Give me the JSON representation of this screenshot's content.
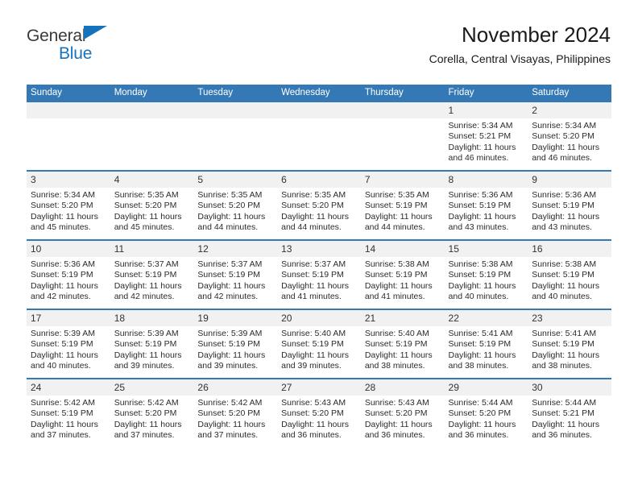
{
  "brand": {
    "name_part1": "General",
    "name_part2": "Blue",
    "accent_color": "#1573bd"
  },
  "header": {
    "title": "November 2024",
    "subtitle": "Corella, Central Visayas, Philippines"
  },
  "calendar": {
    "header_color": "#3479b5",
    "daynum_bg": "#f1f1f1",
    "weekday_headers": [
      "Sunday",
      "Monday",
      "Tuesday",
      "Wednesday",
      "Thursday",
      "Friday",
      "Saturday"
    ],
    "weeks": [
      [
        {
          "day": "",
          "blank": true
        },
        {
          "day": "",
          "blank": true
        },
        {
          "day": "",
          "blank": true
        },
        {
          "day": "",
          "blank": true
        },
        {
          "day": "",
          "blank": true
        },
        {
          "day": "1",
          "sunrise": "Sunrise: 5:34 AM",
          "sunset": "Sunset: 5:21 PM",
          "daylight": "Daylight: 11 hours and 46 minutes."
        },
        {
          "day": "2",
          "sunrise": "Sunrise: 5:34 AM",
          "sunset": "Sunset: 5:20 PM",
          "daylight": "Daylight: 11 hours and 46 minutes."
        }
      ],
      [
        {
          "day": "3",
          "sunrise": "Sunrise: 5:34 AM",
          "sunset": "Sunset: 5:20 PM",
          "daylight": "Daylight: 11 hours and 45 minutes."
        },
        {
          "day": "4",
          "sunrise": "Sunrise: 5:35 AM",
          "sunset": "Sunset: 5:20 PM",
          "daylight": "Daylight: 11 hours and 45 minutes."
        },
        {
          "day": "5",
          "sunrise": "Sunrise: 5:35 AM",
          "sunset": "Sunset: 5:20 PM",
          "daylight": "Daylight: 11 hours and 44 minutes."
        },
        {
          "day": "6",
          "sunrise": "Sunrise: 5:35 AM",
          "sunset": "Sunset: 5:20 PM",
          "daylight": "Daylight: 11 hours and 44 minutes."
        },
        {
          "day": "7",
          "sunrise": "Sunrise: 5:35 AM",
          "sunset": "Sunset: 5:19 PM",
          "daylight": "Daylight: 11 hours and 44 minutes."
        },
        {
          "day": "8",
          "sunrise": "Sunrise: 5:36 AM",
          "sunset": "Sunset: 5:19 PM",
          "daylight": "Daylight: 11 hours and 43 minutes."
        },
        {
          "day": "9",
          "sunrise": "Sunrise: 5:36 AM",
          "sunset": "Sunset: 5:19 PM",
          "daylight": "Daylight: 11 hours and 43 minutes."
        }
      ],
      [
        {
          "day": "10",
          "sunrise": "Sunrise: 5:36 AM",
          "sunset": "Sunset: 5:19 PM",
          "daylight": "Daylight: 11 hours and 42 minutes."
        },
        {
          "day": "11",
          "sunrise": "Sunrise: 5:37 AM",
          "sunset": "Sunset: 5:19 PM",
          "daylight": "Daylight: 11 hours and 42 minutes."
        },
        {
          "day": "12",
          "sunrise": "Sunrise: 5:37 AM",
          "sunset": "Sunset: 5:19 PM",
          "daylight": "Daylight: 11 hours and 42 minutes."
        },
        {
          "day": "13",
          "sunrise": "Sunrise: 5:37 AM",
          "sunset": "Sunset: 5:19 PM",
          "daylight": "Daylight: 11 hours and 41 minutes."
        },
        {
          "day": "14",
          "sunrise": "Sunrise: 5:38 AM",
          "sunset": "Sunset: 5:19 PM",
          "daylight": "Daylight: 11 hours and 41 minutes."
        },
        {
          "day": "15",
          "sunrise": "Sunrise: 5:38 AM",
          "sunset": "Sunset: 5:19 PM",
          "daylight": "Daylight: 11 hours and 40 minutes."
        },
        {
          "day": "16",
          "sunrise": "Sunrise: 5:38 AM",
          "sunset": "Sunset: 5:19 PM",
          "daylight": "Daylight: 11 hours and 40 minutes."
        }
      ],
      [
        {
          "day": "17",
          "sunrise": "Sunrise: 5:39 AM",
          "sunset": "Sunset: 5:19 PM",
          "daylight": "Daylight: 11 hours and 40 minutes."
        },
        {
          "day": "18",
          "sunrise": "Sunrise: 5:39 AM",
          "sunset": "Sunset: 5:19 PM",
          "daylight": "Daylight: 11 hours and 39 minutes."
        },
        {
          "day": "19",
          "sunrise": "Sunrise: 5:39 AM",
          "sunset": "Sunset: 5:19 PM",
          "daylight": "Daylight: 11 hours and 39 minutes."
        },
        {
          "day": "20",
          "sunrise": "Sunrise: 5:40 AM",
          "sunset": "Sunset: 5:19 PM",
          "daylight": "Daylight: 11 hours and 39 minutes."
        },
        {
          "day": "21",
          "sunrise": "Sunrise: 5:40 AM",
          "sunset": "Sunset: 5:19 PM",
          "daylight": "Daylight: 11 hours and 38 minutes."
        },
        {
          "day": "22",
          "sunrise": "Sunrise: 5:41 AM",
          "sunset": "Sunset: 5:19 PM",
          "daylight": "Daylight: 11 hours and 38 minutes."
        },
        {
          "day": "23",
          "sunrise": "Sunrise: 5:41 AM",
          "sunset": "Sunset: 5:19 PM",
          "daylight": "Daylight: 11 hours and 38 minutes."
        }
      ],
      [
        {
          "day": "24",
          "sunrise": "Sunrise: 5:42 AM",
          "sunset": "Sunset: 5:19 PM",
          "daylight": "Daylight: 11 hours and 37 minutes."
        },
        {
          "day": "25",
          "sunrise": "Sunrise: 5:42 AM",
          "sunset": "Sunset: 5:20 PM",
          "daylight": "Daylight: 11 hours and 37 minutes."
        },
        {
          "day": "26",
          "sunrise": "Sunrise: 5:42 AM",
          "sunset": "Sunset: 5:20 PM",
          "daylight": "Daylight: 11 hours and 37 minutes."
        },
        {
          "day": "27",
          "sunrise": "Sunrise: 5:43 AM",
          "sunset": "Sunset: 5:20 PM",
          "daylight": "Daylight: 11 hours and 36 minutes."
        },
        {
          "day": "28",
          "sunrise": "Sunrise: 5:43 AM",
          "sunset": "Sunset: 5:20 PM",
          "daylight": "Daylight: 11 hours and 36 minutes."
        },
        {
          "day": "29",
          "sunrise": "Sunrise: 5:44 AM",
          "sunset": "Sunset: 5:20 PM",
          "daylight": "Daylight: 11 hours and 36 minutes."
        },
        {
          "day": "30",
          "sunrise": "Sunrise: 5:44 AM",
          "sunset": "Sunset: 5:21 PM",
          "daylight": "Daylight: 11 hours and 36 minutes."
        }
      ]
    ]
  }
}
